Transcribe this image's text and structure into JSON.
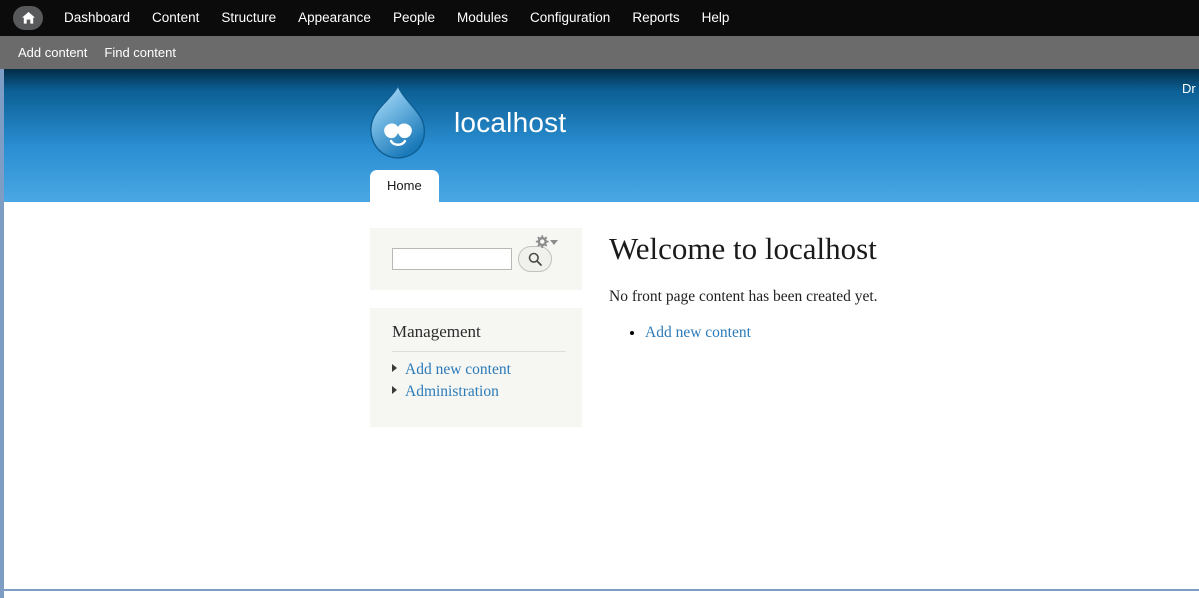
{
  "toolbar": {
    "home_icon": "home-icon",
    "items": [
      {
        "label": "Dashboard"
      },
      {
        "label": "Content"
      },
      {
        "label": "Structure"
      },
      {
        "label": "Appearance"
      },
      {
        "label": "People"
      },
      {
        "label": "Modules"
      },
      {
        "label": "Configuration"
      },
      {
        "label": "Reports"
      },
      {
        "label": "Help"
      }
    ]
  },
  "shortcuts": {
    "items": [
      {
        "label": "Add content"
      },
      {
        "label": "Find content"
      }
    ]
  },
  "header": {
    "site_name": "localhost",
    "logo_icon": "drupal-droplet-icon",
    "secondary_menu_clipped": "Dr",
    "tabs": [
      {
        "label": "Home",
        "active": true
      }
    ]
  },
  "sidebar": {
    "search_block": {
      "input_value": "",
      "input_placeholder": "",
      "search_icon": "magnifier-icon",
      "contextual_icon": "gear-icon",
      "contextual_caret": "chevron-down-icon"
    },
    "menu_block": {
      "title": "Management",
      "items": [
        {
          "label": "Add new content"
        },
        {
          "label": "Administration"
        }
      ]
    }
  },
  "main": {
    "heading": "Welcome to localhost",
    "body_text": "No front page content has been created yet.",
    "links": [
      {
        "label": "Add new content"
      }
    ]
  },
  "colors": {
    "toolbar_bg": "#0b0b0b",
    "shortcut_bg": "#6b6b6b",
    "header_blue_top": "#022c45",
    "header_blue_bottom": "#4aa7e3",
    "link_blue": "#2b7bb9",
    "block_bg": "#f6f6f2",
    "page_border": "#7d9dc4"
  }
}
